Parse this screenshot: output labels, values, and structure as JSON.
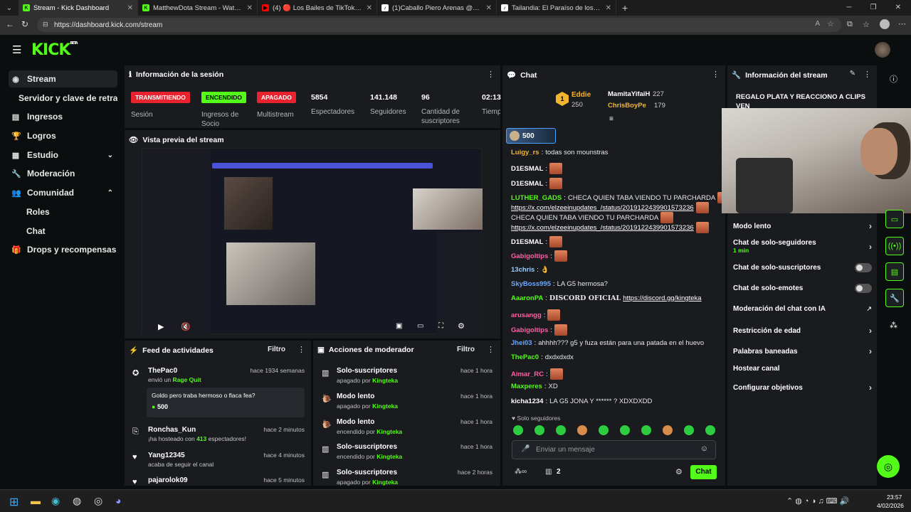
{
  "browser": {
    "tabs": [
      {
        "title": "Stream - Kick Dashboard",
        "color": "#53fc18",
        "glyph": "K",
        "active": true
      },
      {
        "title": "MatthewDota Stream - Watch Liv",
        "color": "#53fc18",
        "glyph": "K",
        "active": false
      },
      {
        "title": "(4) 🔴 Los Bailes de TikTok Más V",
        "color": "#ff0000",
        "glyph": "▶",
        "active": false
      },
      {
        "title": "(1)Caballo Piero Arenas @pieroar",
        "color": "#ffffff",
        "glyph": "♪",
        "active": false
      },
      {
        "title": "Tailandia: El Paraíso de los Jubilad",
        "color": "#ffffff",
        "glyph": "♪",
        "active": false
      }
    ],
    "url": "https://dashboard.kick.com/stream"
  },
  "brand": {
    "logo": "KICK",
    "beta": "BETA",
    "accent": "#53fc18"
  },
  "sidebar": {
    "items": [
      {
        "label": "Stream",
        "icon": "broadcast-icon"
      },
      {
        "label": "Servidor y clave de retransmisión",
        "icon": ""
      },
      {
        "label": "Ingresos",
        "icon": "wallet-icon"
      },
      {
        "label": "Logros",
        "icon": "trophy-icon"
      },
      {
        "label": "Estudio",
        "icon": "studio-icon"
      },
      {
        "label": "Moderación",
        "icon": "wrench-icon"
      },
      {
        "label": "Comunidad",
        "icon": "people-icon"
      },
      {
        "label": "Roles",
        "icon": ""
      },
      {
        "label": "Chat",
        "icon": ""
      },
      {
        "label": "Drops y recompensas",
        "icon": "gift-icon"
      }
    ]
  },
  "session": {
    "title": "Información de la sesión",
    "stats": [
      {
        "badge": "TRANSMITIENDO",
        "label": "Sesión"
      },
      {
        "badge": "ENCENDIDO",
        "label": "Ingresos de Socio"
      },
      {
        "badge": "APAGADO",
        "label": "Multistream"
      },
      {
        "value": "5854",
        "label": "Espectadores"
      },
      {
        "value": "141.148",
        "label": "Seguidores"
      },
      {
        "value": "96",
        "label": "Cantidad de suscriptores"
      },
      {
        "value": "02:13",
        "label": "Tiempo en vivo"
      }
    ]
  },
  "preview": {
    "title": "Vista previa del stream"
  },
  "feed": {
    "title": "Feed de actividades",
    "filter": "Filtro",
    "items": [
      {
        "name": "ThePac0",
        "time": "hace 1934 semanas",
        "sub_prefix": "envió un",
        "sub_hl": "Rage Quit",
        "message": "Goldo pero traba hermoso o flaca fea?",
        "amount": "500"
      },
      {
        "name": "Ronchas_Kun",
        "time": "hace 2 minutos",
        "sub_prefix": "¡ha hosteado con",
        "sub_hl": "413",
        "sub_suffix": "espectadores!"
      },
      {
        "name": "Yang12345",
        "time": "hace 4 minutos",
        "sub_prefix": "acaba de seguir el canal"
      },
      {
        "name": "pajarolok09",
        "time": "hace 5 minutos"
      }
    ]
  },
  "modactions": {
    "title": "Acciones de moderador",
    "filter": "Filtro",
    "items": [
      {
        "name": "Solo-suscriptores",
        "time": "hace 1 hora",
        "state": "apagado por",
        "by": "Kingteka"
      },
      {
        "name": "Modo lento",
        "time": "hace 1 hora",
        "state": "apagado por",
        "by": "Kingteka"
      },
      {
        "name": "Modo lento",
        "time": "hace 1 hora",
        "state": "encendido por",
        "by": "Kingteka"
      },
      {
        "name": "Solo-suscriptores",
        "time": "hace 1 hora",
        "state": "encendido por",
        "by": "Kingteka"
      },
      {
        "name": "Solo-suscriptores",
        "time": "hace 2 horas",
        "state": "apagado por",
        "by": "Kingteka"
      }
    ]
  },
  "chat": {
    "title": "Chat",
    "leaderboard": [
      {
        "rank": "1",
        "name": "Eddie",
        "value": "250"
      },
      {
        "name": "MamitaYifaiH",
        "value": "227"
      },
      {
        "name": "ChrisBoyPe",
        "value": "179"
      }
    ],
    "pinned_amount": "500",
    "messages": [
      {
        "user": "Luigy_rs",
        "cls": "u-y",
        "text": "todas son mounstras"
      },
      {
        "user": "D1ESMAL",
        "cls": "u-w",
        "emote": true
      },
      {
        "user": "D1ESMAL",
        "cls": "u-w",
        "emote": true
      },
      {
        "user": "LUTHER_GADS",
        "cls": "u-g",
        "text": "CHECA QUIEN TABA VIENDO TU PARCHARDA",
        "emote": true
      },
      {
        "user": "",
        "cls": "",
        "link": "https://x.com/elzeeinupdates_/status/2019122439901573236",
        "emote": true
      },
      {
        "user": "",
        "cls": "",
        "text": "CHECA QUIEN TABA VIENDO TU PARCHARDA",
        "emote": true
      },
      {
        "user": "",
        "cls": "",
        "link": "https://x.com/elzeeinupdates_/status/2019122439901573236",
        "emote": true
      },
      {
        "user": "D1ESMAL",
        "cls": "u-w",
        "emote": true
      },
      {
        "user": "Gabigoltips",
        "cls": "u-p",
        "emote": true
      },
      {
        "user": "13chris",
        "cls": "u-l",
        "text": "👌"
      },
      {
        "user": "SkyBoss995",
        "cls": "u-b",
        "text": "LA G5 hermosa?"
      },
      {
        "user": "AaaronPA",
        "cls": "u-g",
        "text": "DISCORD OFICIAL",
        "link": "https://discord.gg/kingteka"
      },
      {
        "user": "arusangg",
        "cls": "u-p",
        "emote": true
      },
      {
        "user": "Gabigoltips",
        "cls": "u-p",
        "emote": true
      },
      {
        "user": "Jhei03",
        "cls": "u-b",
        "text": "ahhhh??? g5 y fuza están para una patada en el huevo"
      },
      {
        "user": "ThePac0",
        "cls": "u-g",
        "text": "dxdxdxdx"
      },
      {
        "user": "Aimar_RC",
        "cls": "u-p",
        "emote": true
      },
      {
        "user": "Maxperes",
        "cls": "u-g",
        "text": "XD"
      },
      {
        "user": "kicha1234",
        "cls": "u-w",
        "text": "LA G5 JONA Y ****** ? XDXDXDD"
      }
    ],
    "followers_only": "Solo seguidores",
    "input_placeholder": "Enviar un mensaje",
    "count": "2",
    "send_label": "Chat"
  },
  "streaminfo": {
    "title": "Información del stream",
    "stream_title": "REGALO PLATA Y REACCIONO A CLIPS VEN",
    "settings": [
      {
        "label": "Modo lento",
        "type": "chevron"
      },
      {
        "label": "Chat de solo-seguidores",
        "sub": "1 min",
        "type": "chevron"
      },
      {
        "label": "Chat de solo-suscriptores",
        "type": "toggle"
      },
      {
        "label": "Chat de solo-emotes",
        "type": "toggle"
      },
      {
        "label": "Moderación del chat con IA",
        "type": "external"
      },
      {
        "label": "Restricción de edad",
        "type": "chevron"
      },
      {
        "label": "Palabras baneadas",
        "type": "chevron"
      },
      {
        "label": "Hostear canal",
        "type": "none"
      },
      {
        "label": "Configurar objetivos",
        "type": "chevron"
      }
    ]
  },
  "taskbar": {
    "time": "23:57",
    "date": "4/02/2026"
  }
}
